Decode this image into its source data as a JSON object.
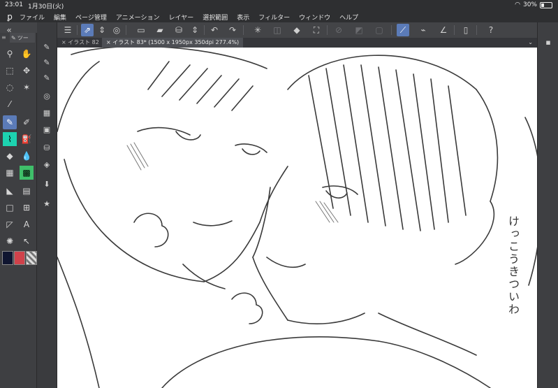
{
  "statusbar": {
    "time": "23:01",
    "date": "1月30日(火)",
    "battery": "30%"
  },
  "menu": [
    "ファイル",
    "編集",
    "ページ管理",
    "アニメーション",
    "レイヤー",
    "選択範囲",
    "表示",
    "フィルター",
    "ウィンドウ",
    "ヘルプ"
  ],
  "left_panel": {
    "tab_label": "ツー"
  },
  "tabs": [
    {
      "label": "× イラスト 82"
    },
    {
      "label": "× イラスト 83* (1500 x 1950px 350dpi 277.4%)"
    }
  ],
  "canvas": {
    "handwritten_text": "けっこうきついわ"
  },
  "colors": {
    "main": "#0f1530",
    "sub": "#d0424b",
    "accent": "#5b7bb8"
  }
}
